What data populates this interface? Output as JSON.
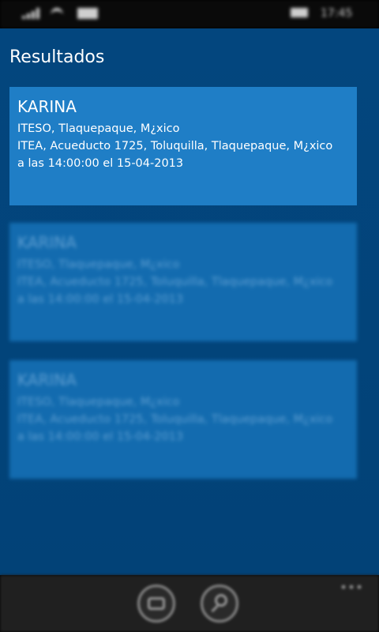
{
  "status_bar": {
    "time": "17:45"
  },
  "page": {
    "title": "Resultados"
  },
  "results": [
    {
      "name": "KARINA",
      "origin": "ITESO, Tlaquepaque, M¿xico",
      "destination": "ITEA, Acueducto 1725, Toluquilla, Tlaquepaque, M¿xico",
      "datetime": "a las 14:00:00 el 15-04-2013"
    },
    {
      "name": "KARINA",
      "origin": "ITESO, Tlaquepaque, M¿xico",
      "destination": "ITEA, Acueducto 1725, Toluquilla, Tlaquepaque, M¿xico",
      "datetime": "a las 14:00:00 el 15-04-2013"
    },
    {
      "name": "KARINA",
      "origin": "ITESO, Tlaquepaque, M¿xico",
      "destination": "ITEA, Acueducto 1725, Toluquilla, Tlaquepaque, M¿xico",
      "datetime": "a las 14:00:00 el 15-04-2013"
    }
  ],
  "app_bar": {
    "buttons": [
      {
        "icon": "map-icon"
      },
      {
        "icon": "search-icon"
      }
    ],
    "more_icon": "ellipsis-icon"
  },
  "colors": {
    "background": "#03467e",
    "card": "#1f7ec6",
    "app_bar": "#202020"
  }
}
